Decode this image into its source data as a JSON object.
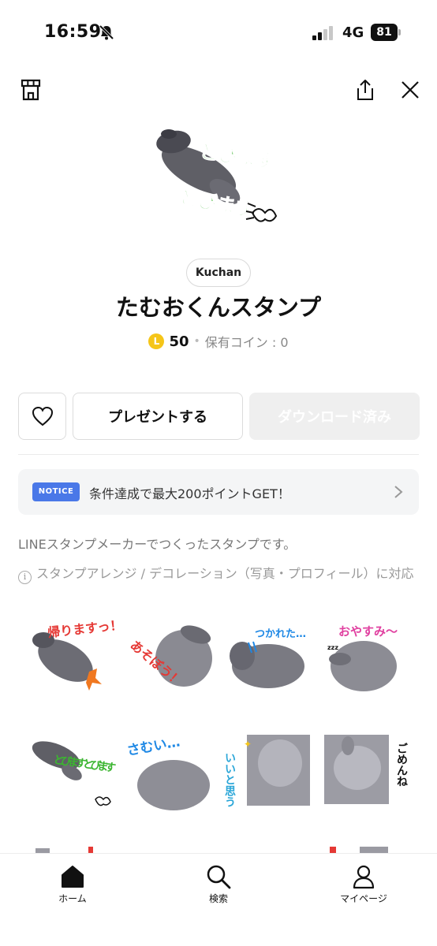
{
  "status_bar": {
    "time": "16:59",
    "network": "4G",
    "battery": "81"
  },
  "sticker_pack": {
    "author": "Kuchan",
    "title": "たむおくんスタンプ",
    "price": "50",
    "coin_symbol": "L",
    "owned_coins": "保有コイン : 0"
  },
  "actions": {
    "gift_label": "プレゼントする",
    "download_label": "ダウンロード済み"
  },
  "notice": {
    "badge": "NOTICE",
    "text": "条件達成で最大200ポイントGET！"
  },
  "description": "LINEスタンプメーカーでつくったスタンプです。",
  "feature_note": "スタンプアレンジ / デコレーション（写真・プロフィール）に対応",
  "stickers": [
    {
      "caption": "帰りますっ！",
      "color": "#e53935"
    },
    {
      "caption": "あそぼう！",
      "color": "#e53935"
    },
    {
      "caption": "つかれた…",
      "color": "#1e88e5"
    },
    {
      "caption": "おやすみ〜",
      "color": "#e040a0"
    },
    {
      "caption": "とびますとびます",
      "color": "#3cb531"
    },
    {
      "caption": "さむい…",
      "color": "#1e88e5"
    },
    {
      "caption": "いいと思う",
      "color": "#2aa6d8"
    },
    {
      "caption": "ごめんね",
      "color": "#111111"
    }
  ],
  "main_sticker": {
    "caption_top": "とびます",
    "caption_bottom": "とびます",
    "color": "#3cb531"
  },
  "bottom_nav": [
    {
      "label": "ホーム",
      "icon": "home-icon"
    },
    {
      "label": "検索",
      "icon": "search-icon"
    },
    {
      "label": "マイページ",
      "icon": "person-icon"
    }
  ]
}
